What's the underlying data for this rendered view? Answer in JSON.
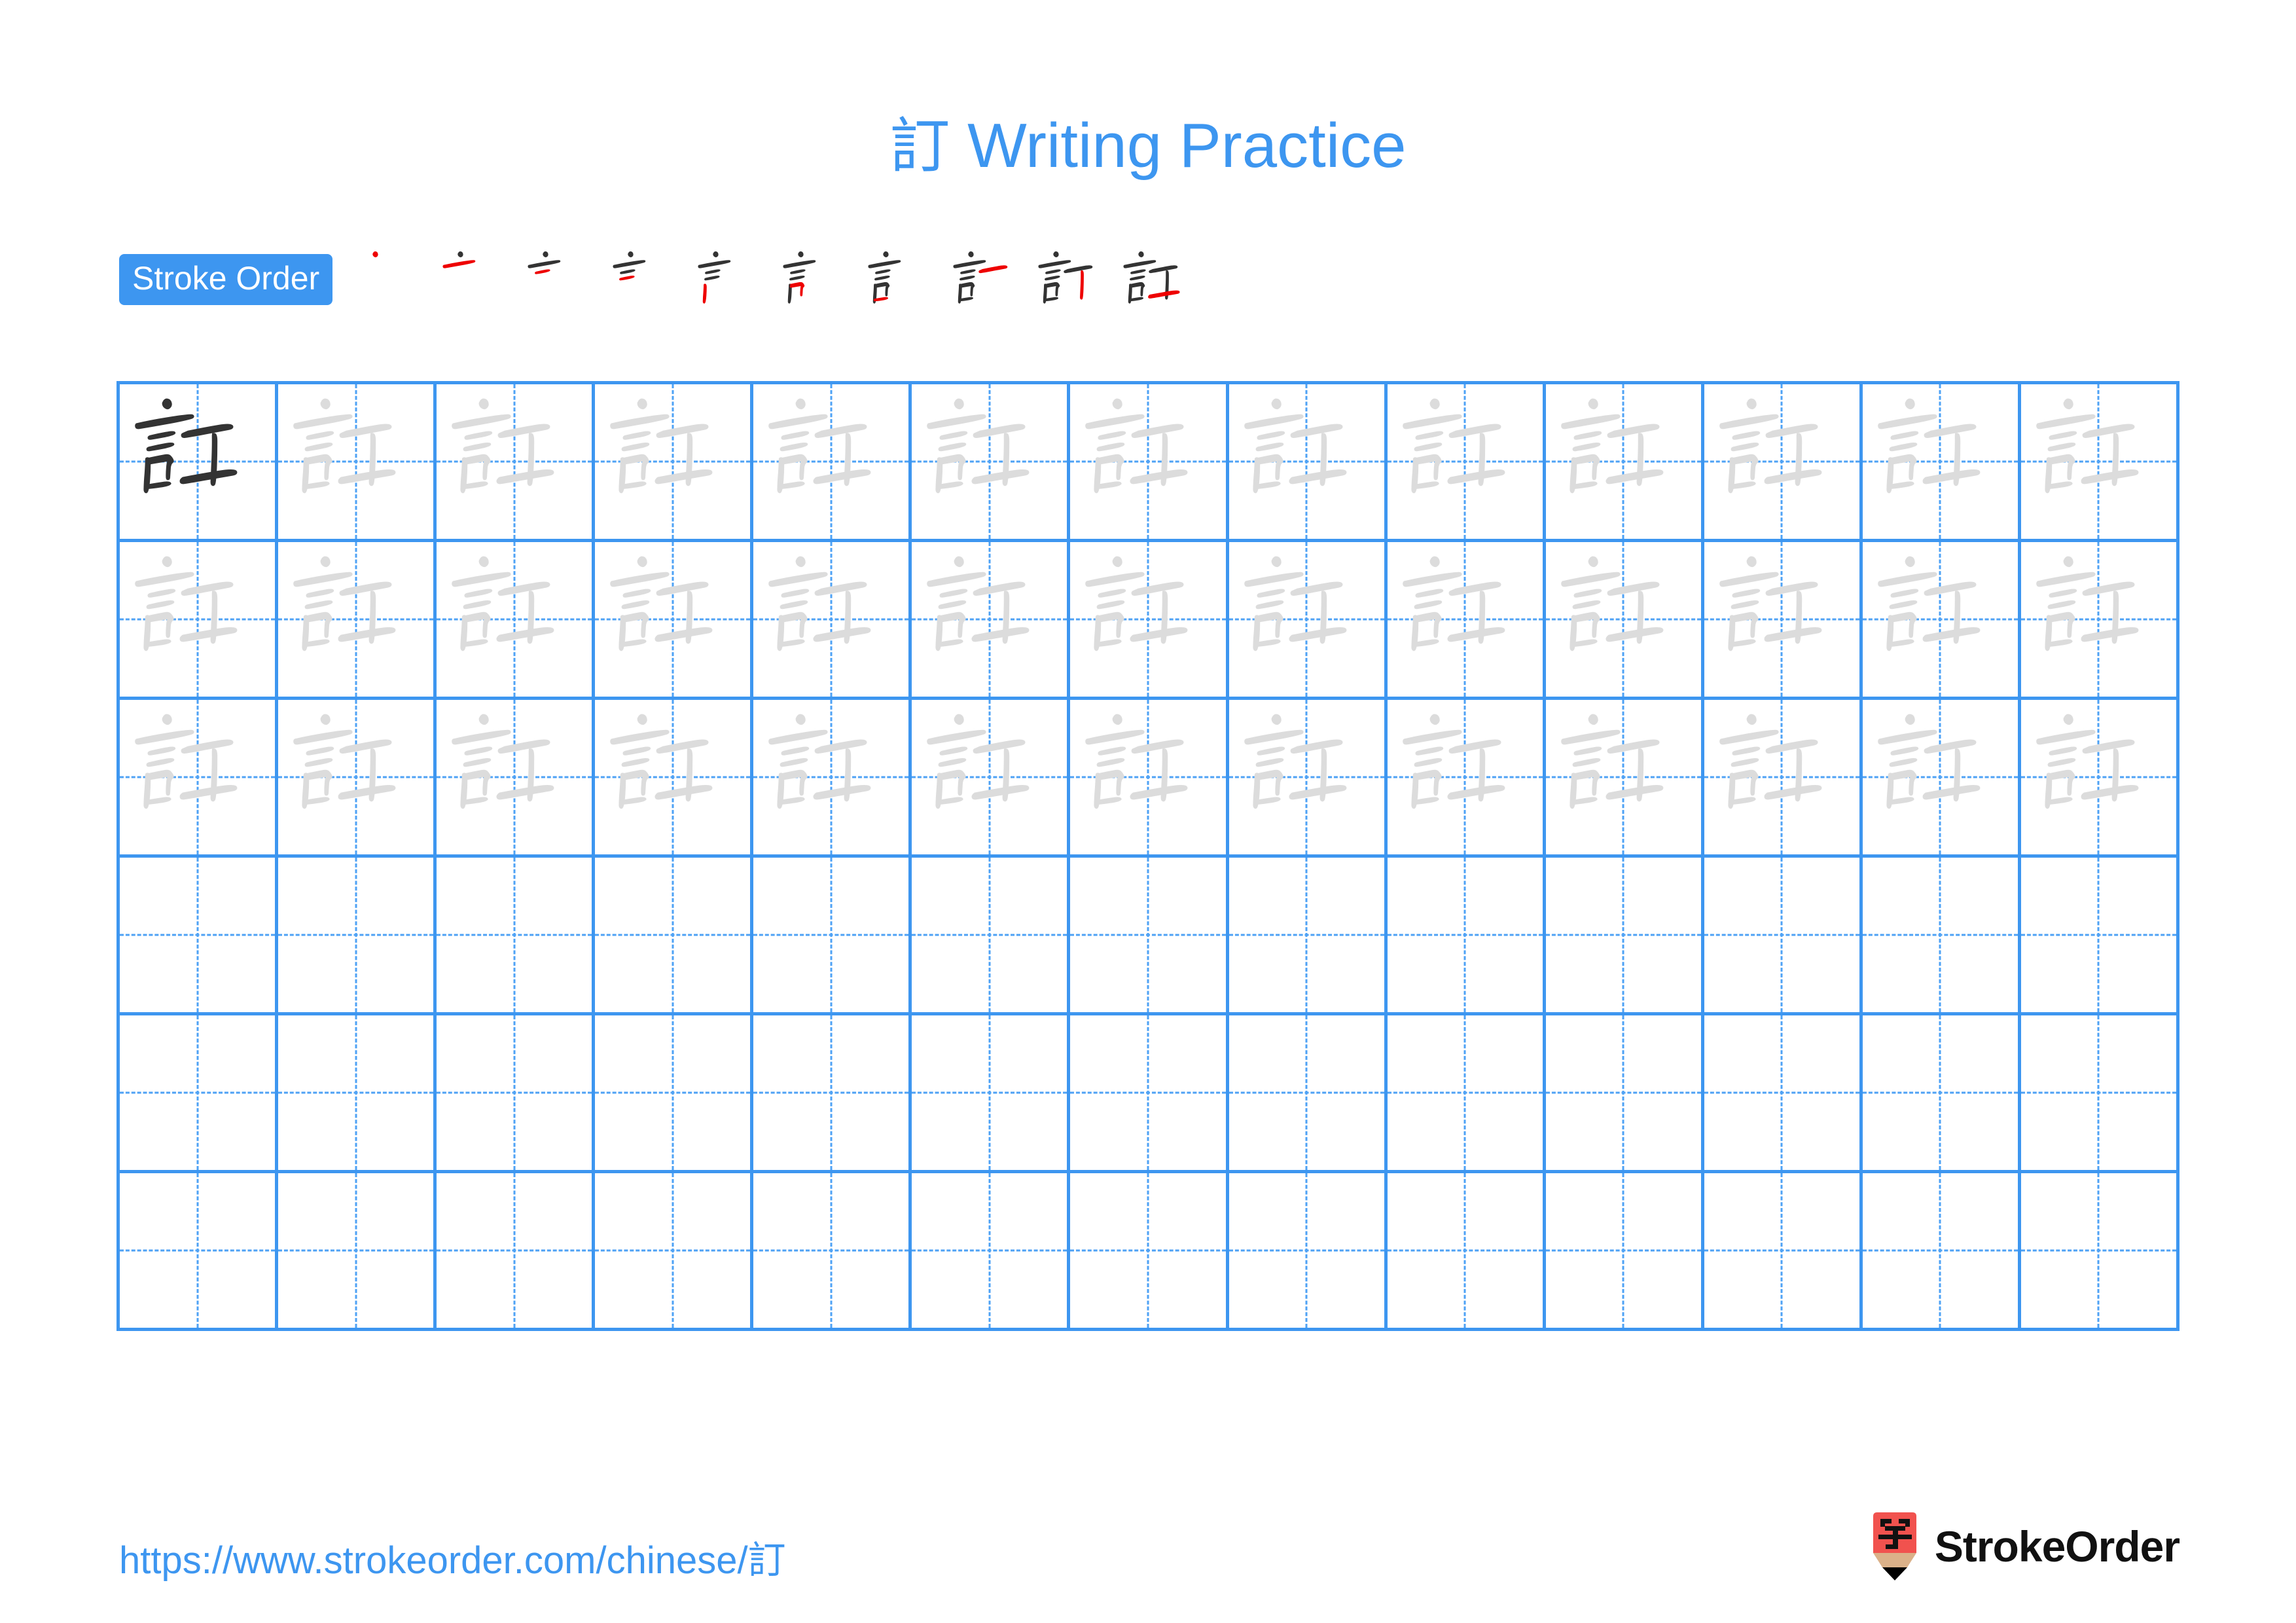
{
  "document": {
    "character": "訂",
    "title": "訂 Writing Practice",
    "title_character": "訂",
    "title_suffix": " Writing Practice",
    "accent_color": "#3d96f0",
    "stroke_color_done": "#333333",
    "stroke_color_new": "#ee0000",
    "trace_color": "#dcdcdc",
    "grid_line_color": "#3d96f0",
    "guide_line_color": "#4ea2f5"
  },
  "stroke_order": {
    "badge_label": "Stroke Order",
    "total_strokes": 10,
    "steps": [
      {
        "index": 1,
        "new_stroke": "dot (丶)",
        "strokes_shown": 1
      },
      {
        "index": 2,
        "new_stroke": "horizontal (一)",
        "strokes_shown": 2
      },
      {
        "index": 3,
        "new_stroke": "horizontal (一)",
        "strokes_shown": 3
      },
      {
        "index": 4,
        "new_stroke": "horizontal (一)",
        "strokes_shown": 4
      },
      {
        "index": 5,
        "new_stroke": "vertical (丨)",
        "strokes_shown": 5
      },
      {
        "index": 6,
        "new_stroke": "horizontal-fold (𠃍)",
        "strokes_shown": 6
      },
      {
        "index": 7,
        "new_stroke": "horizontal (一)",
        "strokes_shown": 7
      },
      {
        "index": 8,
        "new_stroke": "horizontal (一)",
        "strokes_shown": 8
      },
      {
        "index": 9,
        "new_stroke": "vertical hook (亅)",
        "strokes_shown": 9
      },
      {
        "index": 10,
        "new_stroke": "horizontal rise (一)",
        "strokes_shown": 10
      }
    ]
  },
  "practice_grid": {
    "columns": 13,
    "rows": 6,
    "cells": [
      [
        "solid",
        "trace",
        "trace",
        "trace",
        "trace",
        "trace",
        "trace",
        "trace",
        "trace",
        "trace",
        "trace",
        "trace",
        "trace"
      ],
      [
        "trace",
        "trace",
        "trace",
        "trace",
        "trace",
        "trace",
        "trace",
        "trace",
        "trace",
        "trace",
        "trace",
        "trace",
        "trace"
      ],
      [
        "trace",
        "trace",
        "trace",
        "trace",
        "trace",
        "trace",
        "trace",
        "trace",
        "trace",
        "trace",
        "trace",
        "trace",
        "trace"
      ],
      [
        "empty",
        "empty",
        "empty",
        "empty",
        "empty",
        "empty",
        "empty",
        "empty",
        "empty",
        "empty",
        "empty",
        "empty",
        "empty"
      ],
      [
        "empty",
        "empty",
        "empty",
        "empty",
        "empty",
        "empty",
        "empty",
        "empty",
        "empty",
        "empty",
        "empty",
        "empty",
        "empty"
      ],
      [
        "empty",
        "empty",
        "empty",
        "empty",
        "empty",
        "empty",
        "empty",
        "empty",
        "empty",
        "empty",
        "empty",
        "empty",
        "empty"
      ]
    ]
  },
  "footer": {
    "url": "https://www.strokeorder.com/chinese/訂",
    "brand_name": "StrokeOrder",
    "logo_character": "字",
    "logo_body_color": "#f1524e",
    "logo_wood_color": "#dbb189",
    "logo_tip_color": "#000000"
  }
}
